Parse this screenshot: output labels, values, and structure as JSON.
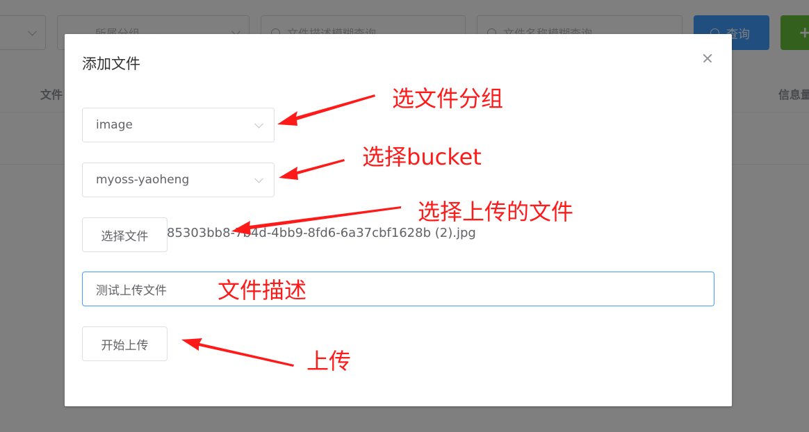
{
  "background": {
    "filters": {
      "group_placeholder": "——所属分组——",
      "desc_search_placeholder": "文件描述模糊查询",
      "name_search_placeholder": "文件名称模糊查询"
    },
    "query_button": "查询",
    "add_button": "+",
    "table_headers": [
      "文件",
      "信息量"
    ]
  },
  "dialog": {
    "title": "添加文件",
    "group_select_value": "image",
    "bucket_select_value": "myoss-yaoheng",
    "choose_file_button": "选择文件",
    "chosen_file_name": "85303bb8-7b4d-4bb9-8fd6-6a37cbf1628b (2).jpg",
    "description_value": "测试上传文件",
    "upload_button": "开始上传"
  },
  "annotations": {
    "select_group": "选文件分组",
    "select_bucket": "选择bucket",
    "select_file": "选择上传的文件",
    "file_description": "文件描述",
    "upload": "上传",
    "color": "#ff1a1a"
  },
  "colors": {
    "primary": "#409eff",
    "success": "#67c23a",
    "mask": "rgba(0,0,0,0.5)"
  }
}
